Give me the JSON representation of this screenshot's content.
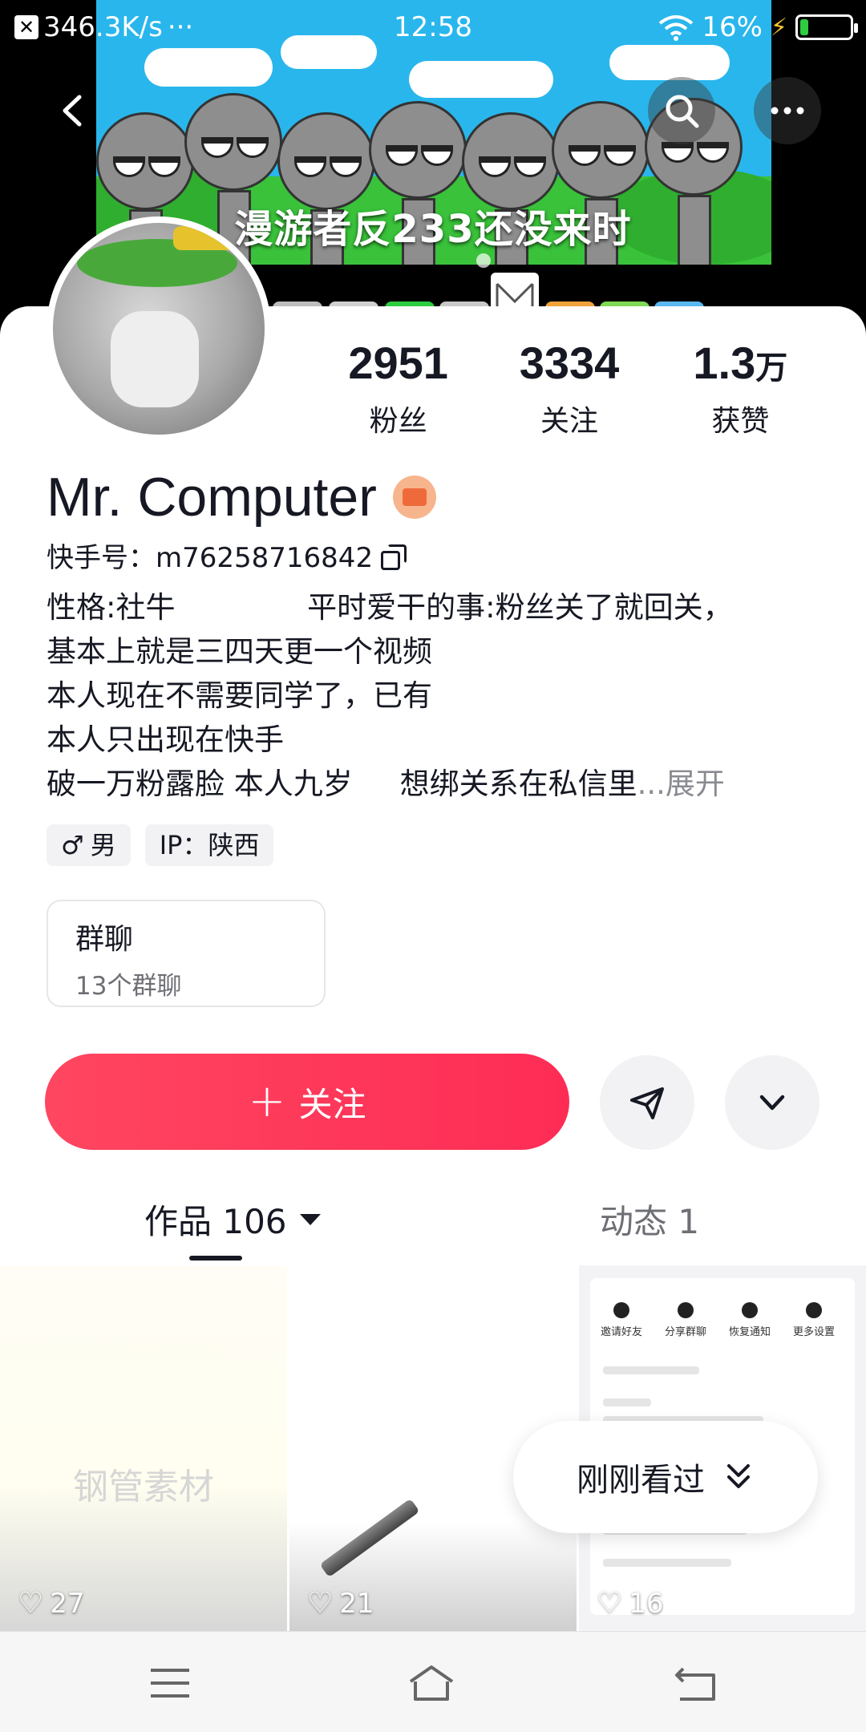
{
  "status_bar": {
    "speed": "346.3K/s",
    "dots": "···",
    "time": "12:58",
    "battery_pct": "16%",
    "battery_level": 0.16
  },
  "cover": {
    "caption": "漫游者反233还没来时"
  },
  "profile": {
    "stats": [
      {
        "value": "2951",
        "unit": "",
        "label": "粉丝"
      },
      {
        "value": "3334",
        "unit": "",
        "label": "关注"
      },
      {
        "value": "1.3",
        "unit": "万",
        "label": "获赞"
      }
    ],
    "name": "Mr. Computer",
    "kuaishou_id": "快手号：m76258716842",
    "bio_lines": [
      "性格:社牛              平时爱干的事:粉丝关了就回关，",
      "基本上就是三四天更一个视频",
      "本人现在不需要同学了，已有",
      "本人只出现在快手",
      "破一万粉露脸 本人九岁     想绑关系在私信里"
    ],
    "bio_ellipsis": "...",
    "bio_expand": "展开",
    "gender_tag": "男",
    "gender_symbol": "♂",
    "ip_tag": "IP：陕西"
  },
  "group_chat": {
    "title": "群聊",
    "subtitle": "13个群聊"
  },
  "actions": {
    "follow_label": "关注",
    "follow_plus": "+"
  },
  "tabs": [
    {
      "label": "作品 106"
    },
    {
      "label": "动态 1"
    }
  ],
  "grid": [
    {
      "overlay_text": "钢管素材",
      "likes": "27"
    },
    {
      "overlay_text": "",
      "likes": "21"
    },
    {
      "overlay_text": "",
      "likes": "16"
    }
  ],
  "mini_panel": {
    "actions": [
      "邀请好友",
      "分享群聊",
      "恢复通知",
      "更多设置"
    ]
  },
  "recent_pill": {
    "label": "刚刚看过"
  },
  "colors": {
    "accent": "#fe2c55",
    "text": "#161823",
    "muted": "#6e6f75"
  }
}
